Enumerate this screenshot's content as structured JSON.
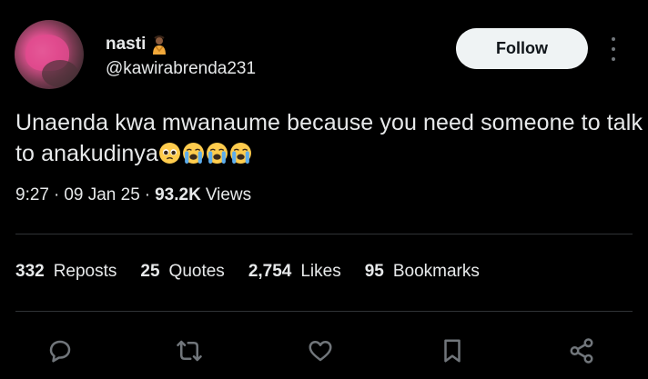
{
  "user": {
    "name": "nasti",
    "handle": "@kawirabrenda231",
    "name_emoji": "person-emoji"
  },
  "follow_label": "Follow",
  "tweet": {
    "text": "Unaenda kwa mwanaume because you need someone to talk to anakudinya",
    "emojis": [
      "pleading-face-emoji",
      "loudly-crying-face-emoji",
      "loudly-crying-face-emoji",
      "loudly-crying-face-emoji"
    ]
  },
  "meta": {
    "time": "9:27",
    "date": "09 Jan 25",
    "separator": "·",
    "views_count": "93.2K",
    "views_label": "Views"
  },
  "stats": {
    "reposts": {
      "count": "332",
      "label": "Reposts"
    },
    "quotes": {
      "count": "25",
      "label": "Quotes"
    },
    "likes": {
      "count": "2,754",
      "label": "Likes"
    },
    "bookmarks": {
      "count": "95",
      "label": "Bookmarks"
    }
  },
  "actions": [
    "reply-icon",
    "repost-icon",
    "like-icon",
    "bookmark-icon",
    "share-icon"
  ],
  "colors": {
    "background": "#000000",
    "text": "#e7e9ea",
    "icon": "#71767b",
    "divider": "#2f3336",
    "follow_bg": "#eff3f4",
    "follow_text": "#0f1419"
  }
}
